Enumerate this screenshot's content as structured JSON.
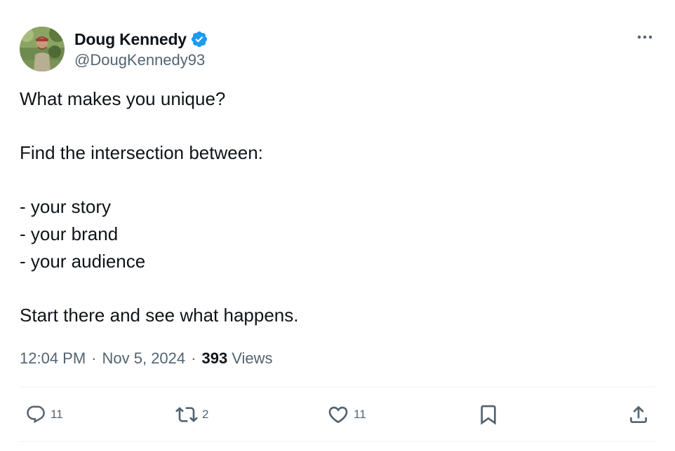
{
  "author": {
    "display_name": "Doug Kennedy",
    "handle": "@DougKennedy93",
    "verified": true,
    "verified_color": "#1d9bf0"
  },
  "tweet": {
    "text": "What makes you unique?\n\nFind the intersection between:\n\n- your story\n- your brand\n- your audience\n\nStart there and see what happens.",
    "time": "12:04 PM",
    "separator": "·",
    "date": "Nov 5, 2024",
    "views_count": "393",
    "views_label": "Views"
  },
  "actions": {
    "replies": "11",
    "reposts": "2",
    "likes": "11"
  },
  "icons": {
    "more": "more-horizontal-icon",
    "reply": "reply-icon",
    "repost": "repost-icon",
    "like": "heart-icon",
    "bookmark": "bookmark-icon",
    "share": "share-icon"
  },
  "colors": {
    "text": "#0f1419",
    "secondary": "#536471",
    "divider": "#eff3f4"
  }
}
